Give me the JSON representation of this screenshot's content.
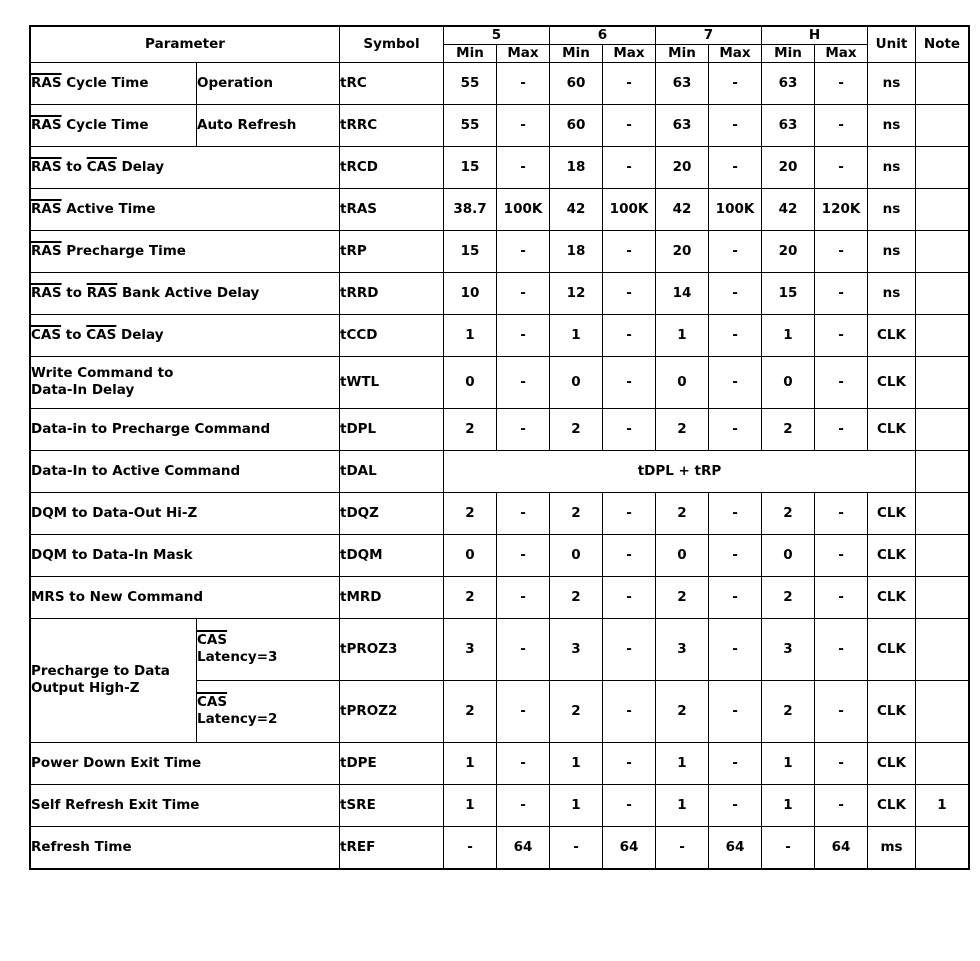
{
  "table": {
    "header": {
      "parameter": "Parameter",
      "symbol": "Symbol",
      "groups": [
        "5",
        "6",
        "7",
        "H"
      ],
      "min": "Min",
      "max": "Max",
      "unit": "Unit",
      "note": "Note"
    },
    "colors": {
      "header_bg": "#E2E2FA",
      "border": "#000000",
      "text": "#000000",
      "page_bg": "#FFFFFF"
    },
    "rows": [
      {
        "param": "RAS Cycle Time",
        "param_overline": "RAS",
        "param2": "Operation",
        "symbol": "tRC",
        "values": [
          "55",
          "-",
          "60",
          "-",
          "63",
          "-",
          "63",
          "-"
        ],
        "unit": "ns",
        "note": ""
      },
      {
        "param": "RAS Cycle Time",
        "param_overline": "RAS",
        "param2": "Auto Refresh",
        "symbol": "tRRC",
        "values": [
          "55",
          "-",
          "60",
          "-",
          "63",
          "-",
          "63",
          "-"
        ],
        "unit": "ns",
        "note": ""
      },
      {
        "param": "RAS to CAS Delay",
        "param_overline": "RAS,CAS",
        "param2": null,
        "symbol": "tRCD",
        "values": [
          "15",
          "-",
          "18",
          "-",
          "20",
          "-",
          "20",
          "-"
        ],
        "unit": "ns",
        "note": ""
      },
      {
        "param": "RAS Active Time",
        "param_overline": "RAS",
        "param2": null,
        "symbol": "tRAS",
        "values": [
          "38.7",
          "100K",
          "42",
          "100K",
          "42",
          "100K",
          "42",
          "120K"
        ],
        "unit": "ns",
        "note": ""
      },
      {
        "param": "RAS Precharge Time",
        "param_overline": "RAS",
        "param2": null,
        "symbol": "tRP",
        "values": [
          "15",
          "-",
          "18",
          "-",
          "20",
          "-",
          "20",
          "-"
        ],
        "unit": "ns",
        "note": ""
      },
      {
        "param": "RAS to RAS Bank Active Delay",
        "param_overline": "RAS,RAS",
        "param2": null,
        "symbol": "tRRD",
        "values": [
          "10",
          "-",
          "12",
          "-",
          "14",
          "-",
          "15",
          "-"
        ],
        "unit": "ns",
        "note": ""
      },
      {
        "param": "CAS to CAS Delay",
        "param_overline": "CAS,CAS",
        "param2": null,
        "symbol": "tCCD",
        "values": [
          "1",
          "-",
          "1",
          "-",
          "1",
          "-",
          "1",
          "-"
        ],
        "unit": "CLK",
        "note": ""
      },
      {
        "param": "Write Command to\nData-In Delay",
        "param_overline": null,
        "param2": null,
        "symbol": "tWTL",
        "values": [
          "0",
          "-",
          "0",
          "-",
          "0",
          "-",
          "0",
          "-"
        ],
        "unit": "CLK",
        "note": ""
      },
      {
        "param": "Data-in to Precharge Command",
        "param_overline": null,
        "param2": null,
        "symbol": "tDPL",
        "values": [
          "2",
          "-",
          "2",
          "-",
          "2",
          "-",
          "2",
          "-"
        ],
        "unit": "CLK",
        "note": ""
      },
      {
        "param": "Data-In to Active Command",
        "param_overline": null,
        "param2": null,
        "symbol": "tDAL",
        "span_value": "tDPL + tRP",
        "values": null,
        "unit": "",
        "note": ""
      },
      {
        "param": "DQM to Data-Out Hi-Z",
        "param_overline": null,
        "param2": null,
        "symbol": "tDQZ",
        "values": [
          "2",
          "-",
          "2",
          "-",
          "2",
          "-",
          "2",
          "-"
        ],
        "unit": "CLK",
        "note": ""
      },
      {
        "param": "DQM to Data-In Mask",
        "param_overline": null,
        "param2": null,
        "symbol": "tDQM",
        "values": [
          "0",
          "-",
          "0",
          "-",
          "0",
          "-",
          "0",
          "-"
        ],
        "unit": "CLK",
        "note": ""
      },
      {
        "param": "MRS to New Command",
        "param_overline": null,
        "param2": null,
        "symbol": "tMRD",
        "values": [
          "2",
          "-",
          "2",
          "-",
          "2",
          "-",
          "2",
          "-"
        ],
        "unit": "CLK",
        "note": ""
      },
      {
        "param": "Precharge to Data\nOutput High-Z",
        "param_overline": null,
        "param2": "CAS\nLatency=3",
        "param2_overline": "CAS",
        "symbol": "tPROZ3",
        "values": [
          "3",
          "-",
          "3",
          "-",
          "3",
          "-",
          "3",
          "-"
        ],
        "unit": "CLK",
        "note": ""
      },
      {
        "param": "",
        "param_overline": null,
        "param2": "CAS\nLatency=2",
        "param2_overline": "CAS",
        "symbol": "tPROZ2",
        "values": [
          "2",
          "-",
          "2",
          "-",
          "2",
          "-",
          "2",
          "-"
        ],
        "unit": "CLK",
        "note": ""
      },
      {
        "param": "Power Down Exit Time",
        "param_overline": null,
        "param2": null,
        "symbol": "tDPE",
        "values": [
          "1",
          "-",
          "1",
          "-",
          "1",
          "-",
          "1",
          "-"
        ],
        "unit": "CLK",
        "note": ""
      },
      {
        "param": "Self Refresh Exit Time",
        "param_overline": null,
        "param2": null,
        "symbol": "tSRE",
        "values": [
          "1",
          "-",
          "1",
          "-",
          "1",
          "-",
          "1",
          "-"
        ],
        "unit": "CLK",
        "note": "1"
      },
      {
        "param": "Refresh Time",
        "param_overline": null,
        "param2": null,
        "symbol": "tREF",
        "values": [
          "-",
          "64",
          "-",
          "64",
          "-",
          "64",
          "-",
          "64"
        ],
        "unit": "ms",
        "note": ""
      }
    ]
  }
}
